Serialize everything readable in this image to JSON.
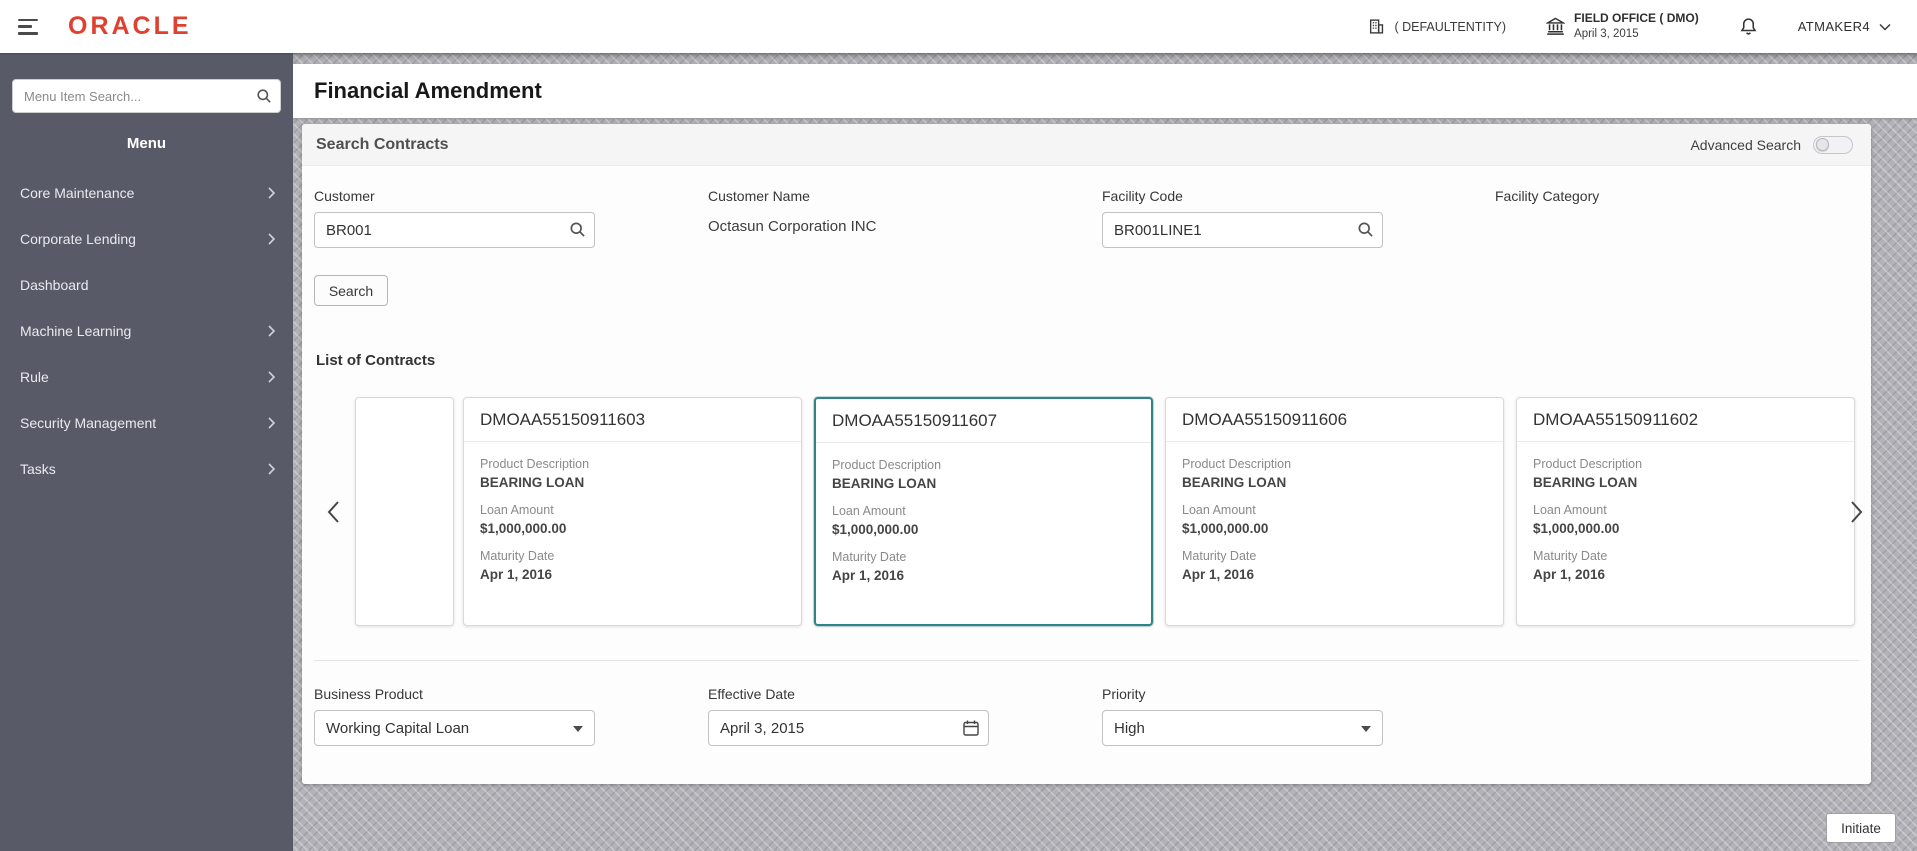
{
  "header": {
    "logo": "ORACLE",
    "entity": "( DEFAULTENTITY)",
    "office": "FIELD OFFICE ( DMO)",
    "office_date": "April 3, 2015",
    "user": "ATMAKER4"
  },
  "sidebar": {
    "search_placeholder": "Menu Item Search...",
    "menu_title": "Menu",
    "items": [
      {
        "label": "Core Maintenance",
        "expandable": true
      },
      {
        "label": "Corporate Lending",
        "expandable": true
      },
      {
        "label": "Dashboard",
        "expandable": false
      },
      {
        "label": "Machine Learning",
        "expandable": true
      },
      {
        "label": "Rule",
        "expandable": true
      },
      {
        "label": "Security Management",
        "expandable": true
      },
      {
        "label": "Tasks",
        "expandable": true
      }
    ]
  },
  "page": {
    "title": "Financial Amendment"
  },
  "search_section": {
    "title": "Search Contracts",
    "advanced_search_label": "Advanced Search",
    "advanced_search_on": false,
    "fields": {
      "customer": {
        "label": "Customer",
        "value": "BR001"
      },
      "customer_name": {
        "label": "Customer Name",
        "value": "Octasun Corporation INC"
      },
      "facility_code": {
        "label": "Facility Code",
        "value": "BR001LINE1"
      },
      "facility_category": {
        "label": "Facility Category",
        "value": ""
      }
    },
    "search_button": "Search"
  },
  "contracts": {
    "title": "List of Contracts",
    "card_labels": {
      "product": "Product Description",
      "loan": "Loan Amount",
      "maturity": "Maturity Date"
    },
    "cards": [
      {
        "id": "DMOAA55150911603",
        "product_description": "BEARING LOAN",
        "loan_amount": "$1,000,000.00",
        "maturity_date": "Apr 1, 2016",
        "selected": false
      },
      {
        "id": "DMOAA55150911607",
        "product_description": "BEARING LOAN",
        "loan_amount": "$1,000,000.00",
        "maturity_date": "Apr 1, 2016",
        "selected": true
      },
      {
        "id": "DMOAA55150911606",
        "product_description": "BEARING LOAN",
        "loan_amount": "$1,000,000.00",
        "maturity_date": "Apr 1, 2016",
        "selected": false
      },
      {
        "id": "DMOAA55150911602",
        "product_description": "BEARING LOAN",
        "loan_amount": "$1,000,000.00",
        "maturity_date": "Apr 1, 2016",
        "selected": false
      }
    ]
  },
  "details_form": {
    "business_product": {
      "label": "Business Product",
      "value": "Working Capital Loan"
    },
    "effective_date": {
      "label": "Effective Date",
      "value": "April 3, 2015"
    },
    "priority": {
      "label": "Priority",
      "value": "High"
    }
  },
  "footer": {
    "initiate_button": "Initiate"
  },
  "colors": {
    "oracle_red": "#e0402f",
    "accent_teal": "#2f8585",
    "sidebar_bg": "#595a68"
  },
  "icons": {
    "hamburger-icon": "≡",
    "search-icon": "⌕",
    "entity-icon": "building",
    "branch-icon": "bank",
    "bell-icon": "bell",
    "chevron-down-icon": "▾",
    "chevron-right-icon": "›",
    "calendar-icon": "calendar",
    "dropdown-caret-icon": "▾",
    "carousel-left-icon": "‹",
    "carousel-right-icon": "›"
  }
}
